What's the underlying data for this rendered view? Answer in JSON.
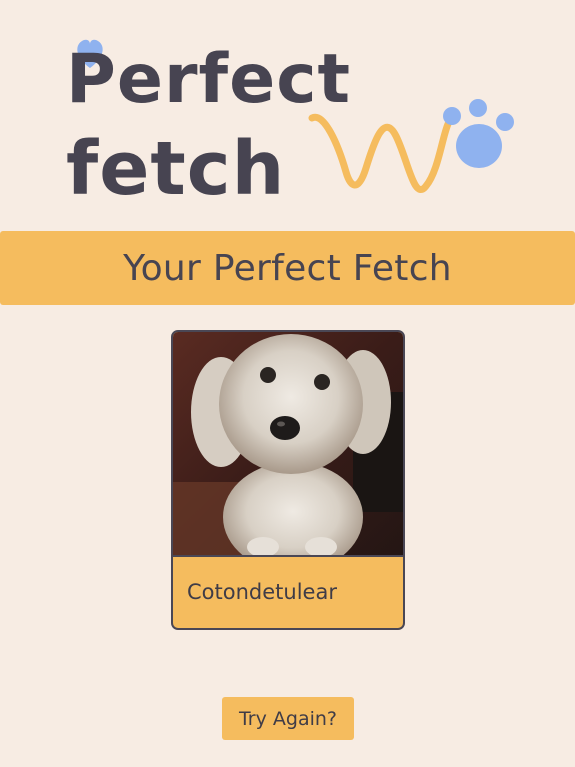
{
  "brand": {
    "line1": "Perfect",
    "line2": "fetch",
    "colors": {
      "text": "#474451",
      "heart": "#8fb2ef",
      "paw": "#8fb2ef",
      "squiggle": "#f5bc5e"
    }
  },
  "banner": {
    "title": "Your Perfect Fetch"
  },
  "result_card": {
    "breed_name": "Cotondetulear"
  },
  "actions": {
    "try_again_label": "Try Again?"
  },
  "icons": {
    "logo_heart": "heart-icon",
    "logo_paw": "paw-print-icon"
  },
  "colors": {
    "background": "#f7ece3",
    "accent": "#f5bc5e",
    "text": "#474451"
  }
}
